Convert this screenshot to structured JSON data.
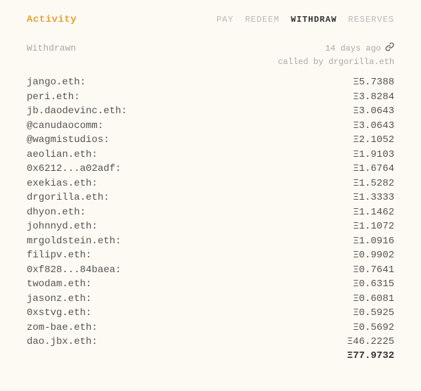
{
  "header": {
    "title": "Activity",
    "tabs": [
      {
        "label": "PAY",
        "active": false
      },
      {
        "label": "REDEEM",
        "active": false
      },
      {
        "label": "WITHDRAW",
        "active": true
      },
      {
        "label": "RESERVES",
        "active": false
      }
    ]
  },
  "subheader": {
    "withdrawn_label": "Withdrawn",
    "time_ago": "14 days ago",
    "link_icon": "link-icon",
    "called_by_prefix": "called by ",
    "called_by_name": "drgorilla.eth"
  },
  "currency_symbol": "Ξ",
  "entries": [
    {
      "name": "jango.eth:",
      "value": "5.7388"
    },
    {
      "name": "peri.eth:",
      "value": "3.8284"
    },
    {
      "name": "jb.daodevinc.eth:",
      "value": "3.0643"
    },
    {
      "name": "@canudaocomm:",
      "value": "3.0643"
    },
    {
      "name": "@wagmistudios:",
      "value": "2.1052"
    },
    {
      "name": "aeolian.eth:",
      "value": "1.9103"
    },
    {
      "name": "0x6212...a02adf:",
      "value": "1.6764"
    },
    {
      "name": "exekias.eth:",
      "value": "1.5282"
    },
    {
      "name": "drgorilla.eth:",
      "value": "1.3333"
    },
    {
      "name": "dhyon.eth:",
      "value": "1.1462"
    },
    {
      "name": "johnnyd.eth:",
      "value": "1.1072"
    },
    {
      "name": "mrgoldstein.eth:",
      "value": "1.0916"
    },
    {
      "name": "filipv.eth:",
      "value": "0.9902"
    },
    {
      "name": "0xf828...84baea:",
      "value": "0.7641"
    },
    {
      "name": "twodam.eth:",
      "value": "0.6315"
    },
    {
      "name": "jasonz.eth:",
      "value": "0.6081"
    },
    {
      "name": "0xstvg.eth:",
      "value": "0.5925"
    },
    {
      "name": "zom-bae.eth:",
      "value": "0.5692"
    },
    {
      "name": "dao.jbx.eth:",
      "value": "46.2225"
    }
  ],
  "total": "77.9732"
}
